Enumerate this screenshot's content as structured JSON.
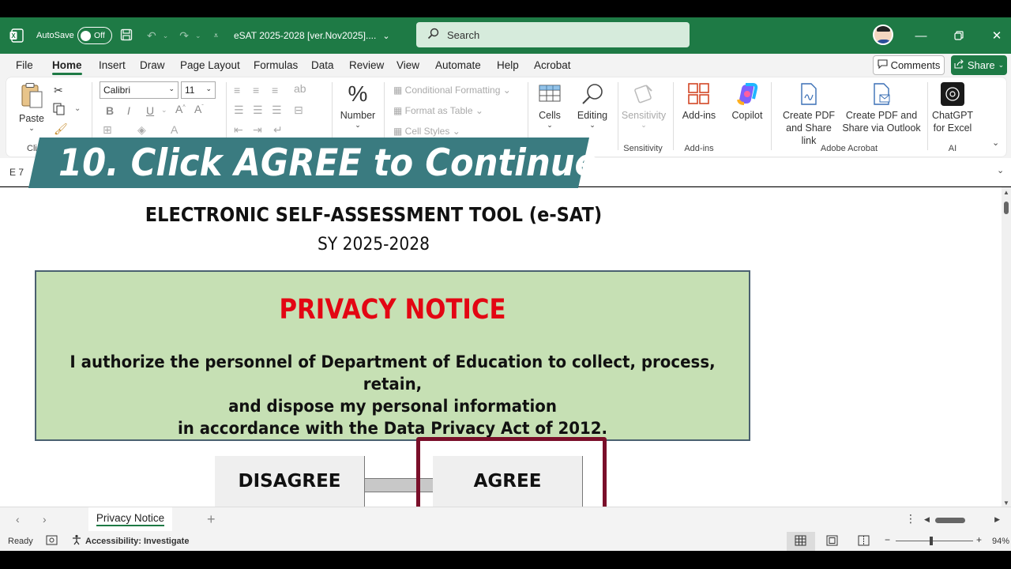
{
  "titlebar": {
    "autosave_label": "AutoSave",
    "autosave_state": "Off",
    "document_title": "eSAT 2025-2028 [ver.Nov2025]....",
    "search_placeholder": "Search",
    "accent_color": "#1e7a45"
  },
  "menu": {
    "items": [
      "File",
      "Home",
      "Insert",
      "Draw",
      "Page Layout",
      "Formulas",
      "Data",
      "Review",
      "View",
      "Automate",
      "Help",
      "Acrobat"
    ],
    "active": "Home",
    "comments_label": "Comments",
    "share_label": "Share"
  },
  "ribbon": {
    "paste_label": "Paste",
    "clipboard_label": "Clip",
    "font_name": "Calibri",
    "font_size": "11",
    "number_label": "Number",
    "conditional_formatting": "Conditional Formatting",
    "format_as_table": "Format as Table",
    "cell_styles": "Cell Styles",
    "cells_label": "Cells",
    "editing_label": "Editing",
    "sensitivity_btn": "Sensitivity",
    "sensitivity_group": "Sensitivity",
    "addins_btn": "Add-ins",
    "addins_group": "Add-ins",
    "copilot_label": "Copilot",
    "create_pdf_line1": "Create PDF",
    "create_pdf_line2": "and Share link",
    "create_pdf_outlook_line1": "Create PDF and",
    "create_pdf_outlook_line2": "Share via Outlook",
    "adobe_group": "Adobe Acrobat",
    "chatgpt_line1": "ChatGPT",
    "chatgpt_line2": "for Excel",
    "ai_group": "AI"
  },
  "formula_bar": {
    "name_box": "E 7"
  },
  "banner": {
    "text": "10. Click AGREE to Continue",
    "color": "#3a7b80"
  },
  "sheet": {
    "title": "ELECTRONIC SELF-ASSESSMENT TOOL (e-SAT)",
    "subtitle": "SY 2025-2028",
    "notice_title": "PRIVACY NOTICE",
    "notice_line1": "I authorize the personnel of Department of Education to collect, process, retain,",
    "notice_line2": "and dispose my personal information",
    "notice_line3": "in accordance with the Data Privacy Act of 2012.",
    "disagree_label": "DISAGREE",
    "agree_label": "AGREE",
    "notice_bg": "#c6e0b4",
    "notice_title_color": "#e30613",
    "highlight_color": "#7a0f2a"
  },
  "tabs": {
    "sheet_name": "Privacy Notice"
  },
  "status": {
    "ready": "Ready",
    "accessibility": "Accessibility: Investigate",
    "zoom": "94%"
  }
}
